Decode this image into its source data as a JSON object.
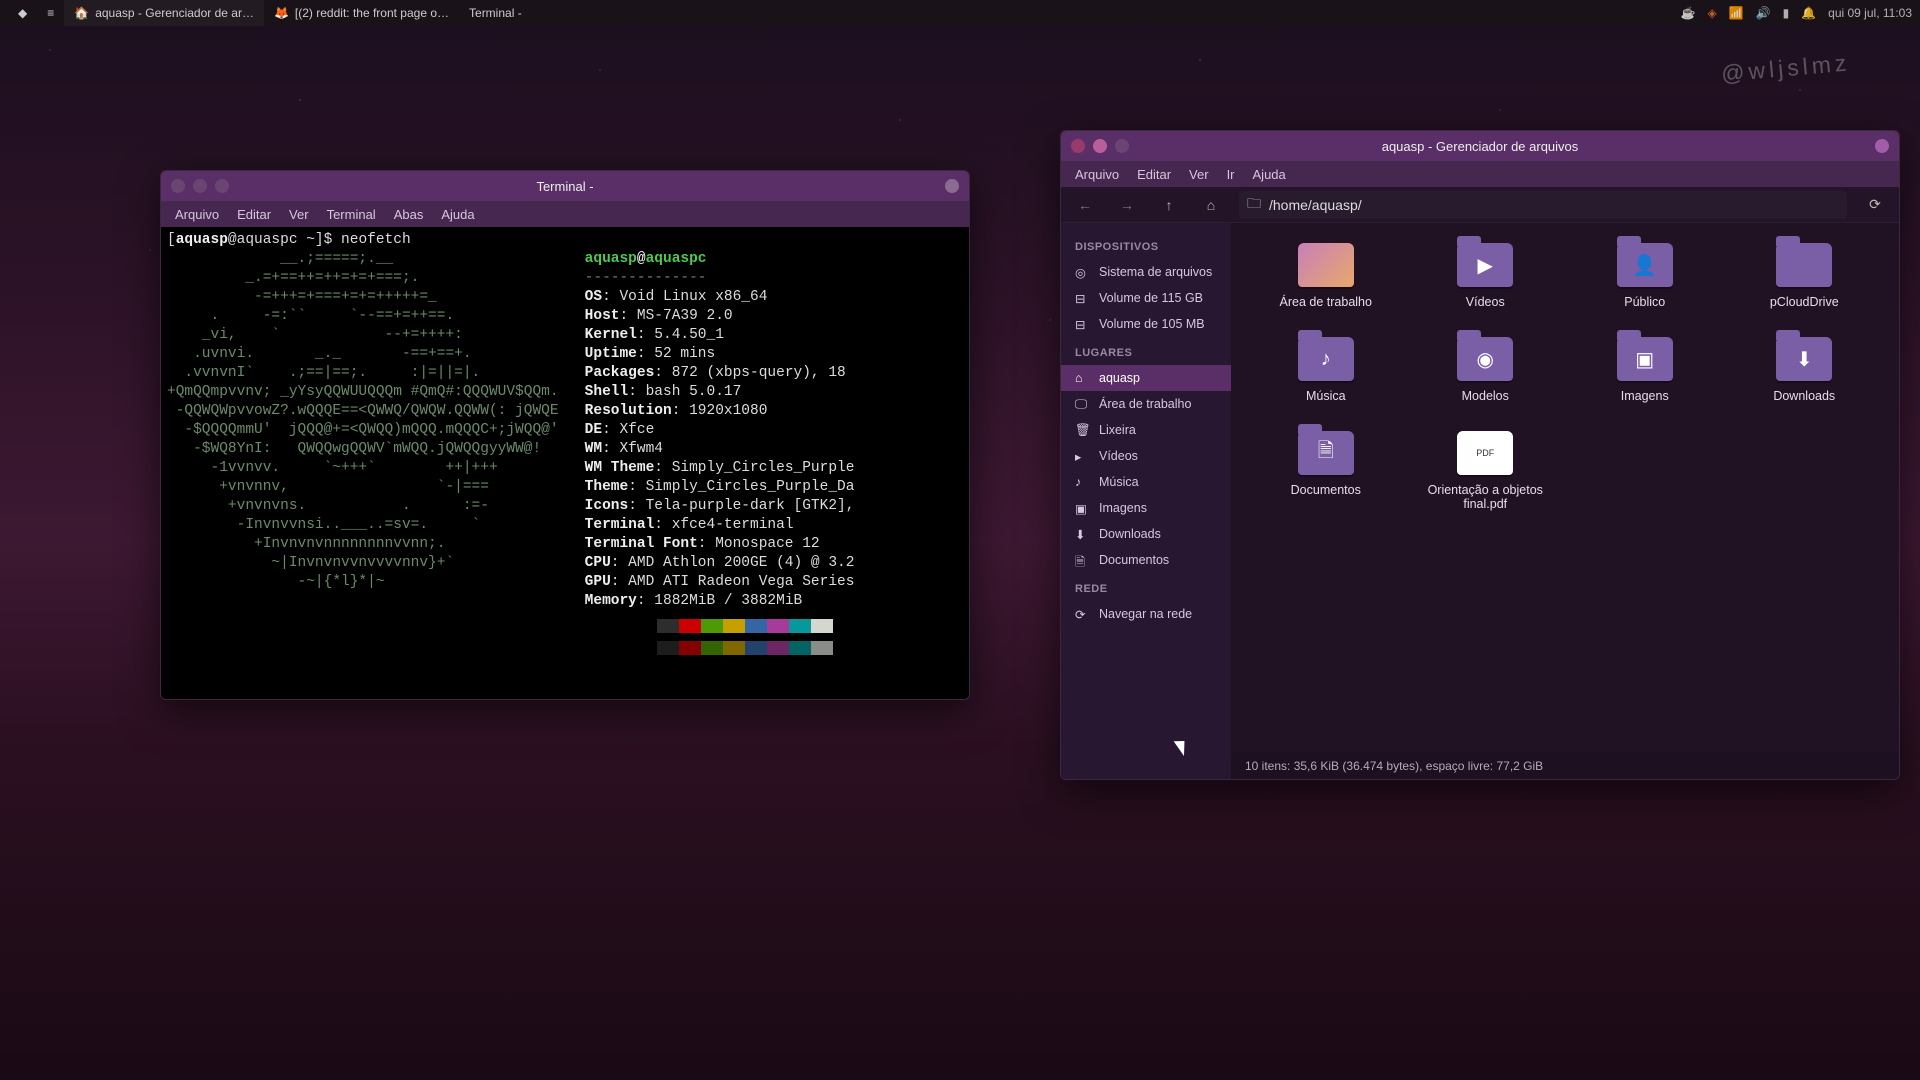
{
  "panel": {
    "tasks": [
      {
        "icon": "🏠",
        "label": "aquasp - Gerenciador de ar…"
      },
      {
        "icon": "",
        "label": "[(2) reddit: the front page o…"
      },
      {
        "icon": "",
        "label": "Terminal -"
      }
    ],
    "clock": "qui 09 jul, 11:03"
  },
  "watermark": "@wljslmz",
  "terminal": {
    "title": "Terminal -",
    "menus": [
      "Arquivo",
      "Editar",
      "Ver",
      "Terminal",
      "Abas",
      "Ajuda"
    ],
    "prompt_user": "aquasp",
    "prompt_host": "aquaspc",
    "prompt_path": "~",
    "prompt_symbol": "$",
    "command": "neofetch",
    "identity_user": "aquasp",
    "identity_at": "@",
    "identity_host": "aquaspc",
    "underline": "--------------",
    "info": [
      {
        "k": "OS",
        "v": "Void Linux x86_64"
      },
      {
        "k": "Host",
        "v": "MS-7A39 2.0"
      },
      {
        "k": "Kernel",
        "v": "5.4.50_1"
      },
      {
        "k": "Uptime",
        "v": "52 mins"
      },
      {
        "k": "Packages",
        "v": "872 (xbps-query), 18"
      },
      {
        "k": "Shell",
        "v": "bash 5.0.17"
      },
      {
        "k": "Resolution",
        "v": "1920x1080"
      },
      {
        "k": "DE",
        "v": "Xfce"
      },
      {
        "k": "WM",
        "v": "Xfwm4"
      },
      {
        "k": "WM Theme",
        "v": "Simply_Circles_Purple"
      },
      {
        "k": "Theme",
        "v": "Simply_Circles_Purple_Da"
      },
      {
        "k": "Icons",
        "v": "Tela-purple-dark [GTK2],"
      },
      {
        "k": "Terminal",
        "v": "xfce4-terminal"
      },
      {
        "k": "Terminal Font",
        "v": "Monospace 12"
      },
      {
        "k": "CPU",
        "v": "AMD Athlon 200GE (4) @ 3.2"
      },
      {
        "k": "GPU",
        "v": "AMD ATI Radeon Vega Series"
      },
      {
        "k": "Memory",
        "v": "1882MiB / 3882MiB"
      }
    ],
    "ascii": [
      "             __.;=====;.__",
      "         _.=+==++=++=+=+===;.",
      "          -=+++=+===+=+=+++++=_",
      "     .     -=:``     `--==+=++==.",
      "    _vi,    `            --+=++++:",
      "   .uvnvi.       _._       -==+==+.",
      "  .vvnvnI`    .;==|==;.     :|=||=|.",
      "+QmQQmpvvnv; _yYsyQQWUUQQQm #QmQ#:QQQWUV$QQm.",
      " -QQWQWpvvowZ?.wQQQE==<QWWQ/QWQW.QQWW(: jQWQE",
      "  -$QQQQmmU'  jQQQ@+=<QWQQ)mQQQ.mQQQC+;jWQQ@'",
      "   -$WQ8YnI:   QWQQwgQQWV`mWQQ.jQWQQgyyWW@!",
      "     -1vvnvv.     `~+++`        ++|+++",
      "      +vnvnnv,                 `-|===",
      "       +vnvnvns.           .      :=-",
      "        -Invnvvnsi..___..=sv=.     `",
      "          +Invnvnvnnnnnnnnvvnn;.",
      "            ~|Invnvnvvnvvvvnnv}+`",
      "               -~|{*l}*|~"
    ],
    "colors": [
      "#2d2d2d",
      "#cc0000",
      "#4e9a06",
      "#c4a000",
      "#3465a4",
      "#a83a9a",
      "#06989a",
      "#d3d7cf"
    ]
  },
  "filemanager": {
    "title": "aquasp - Gerenciador de arquivos",
    "menus": [
      "Arquivo",
      "Editar",
      "Ver",
      "Ir",
      "Ajuda"
    ],
    "path": "/home/aquasp/",
    "sidebar": {
      "devices_heading": "DISPOSITIVOS",
      "devices": [
        {
          "icon": "◎",
          "label": "Sistema de arquivos"
        },
        {
          "icon": "⊟",
          "label": "Volume de 115 GB"
        },
        {
          "icon": "⊟",
          "label": "Volume de 105 MB"
        }
      ],
      "places_heading": "LUGARES",
      "places": [
        {
          "icon": "⌂",
          "label": "aquasp",
          "active": true
        },
        {
          "icon": "🖵",
          "label": "Área de trabalho"
        },
        {
          "icon": "🗑",
          "label": "Lixeira"
        },
        {
          "icon": "▸",
          "label": "Vídeos"
        },
        {
          "icon": "♪",
          "label": "Música"
        },
        {
          "icon": "▣",
          "label": "Imagens"
        },
        {
          "icon": "⬇",
          "label": "Downloads"
        },
        {
          "icon": "🗎",
          "label": "Documentos"
        }
      ],
      "network_heading": "REDE",
      "network": [
        {
          "icon": "⟳",
          "label": "Navegar na rede"
        }
      ]
    },
    "entries": [
      {
        "type": "desktop",
        "glyph": "",
        "label": "Área de trabalho"
      },
      {
        "type": "folder",
        "glyph": "▶",
        "label": "Vídeos"
      },
      {
        "type": "folder",
        "glyph": "👤",
        "label": "Público"
      },
      {
        "type": "folder",
        "glyph": "",
        "label": "pCloudDrive"
      },
      {
        "type": "folder",
        "glyph": "♪",
        "label": "Música"
      },
      {
        "type": "folder",
        "glyph": "◉",
        "label": "Modelos"
      },
      {
        "type": "folder",
        "glyph": "▣",
        "label": "Imagens"
      },
      {
        "type": "folder",
        "glyph": "⬇",
        "label": "Downloads"
      },
      {
        "type": "folder",
        "glyph": "🗎",
        "label": "Documentos"
      },
      {
        "type": "pdf",
        "glyph": "PDF",
        "label": "Orientação a objetos final.pdf"
      }
    ],
    "status": "10 itens: 35,6 KiB (36.474 bytes), espaço livre: 77,2 GiB"
  }
}
